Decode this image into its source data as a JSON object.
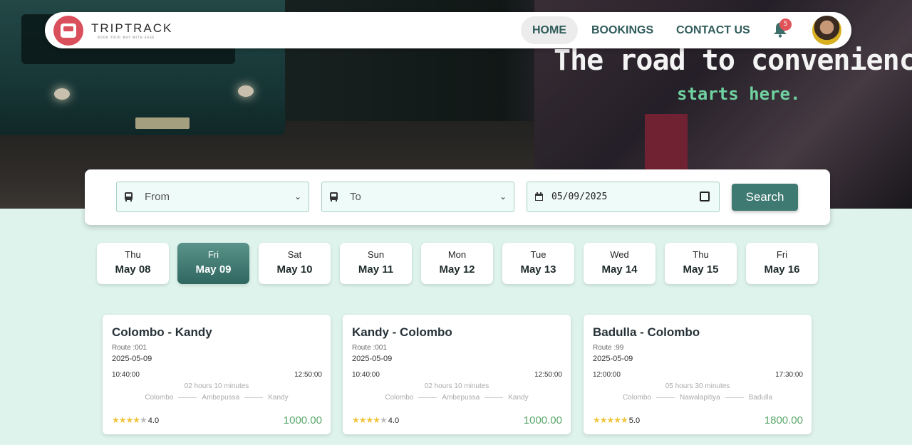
{
  "brand": {
    "name": "TRIPTRACK",
    "tagline": "BOOK YOUR WAY WITH EASE"
  },
  "nav": {
    "items": [
      {
        "label": "HOME",
        "active": true
      },
      {
        "label": "BOOKINGS",
        "active": false
      },
      {
        "label": "CONTACT US",
        "active": false
      }
    ],
    "notifications": "5"
  },
  "hero": {
    "headline": "The road to convenience",
    "subline": "starts here."
  },
  "search": {
    "from_placeholder": "From",
    "to_placeholder": "To",
    "date_value": "05/09/2025",
    "button_label": "Search"
  },
  "days": [
    {
      "weekday": "Thu",
      "date": "May 08",
      "selected": false
    },
    {
      "weekday": "Fri",
      "date": "May 09",
      "selected": true
    },
    {
      "weekday": "Sat",
      "date": "May 10",
      "selected": false
    },
    {
      "weekday": "Sun",
      "date": "May 11",
      "selected": false
    },
    {
      "weekday": "Mon",
      "date": "May 12",
      "selected": false
    },
    {
      "weekday": "Tue",
      "date": "May 13",
      "selected": false
    },
    {
      "weekday": "Wed",
      "date": "May 14",
      "selected": false
    },
    {
      "weekday": "Thu",
      "date": "May 15",
      "selected": false
    },
    {
      "weekday": "Fri",
      "date": "May 16",
      "selected": false
    }
  ],
  "trips": [
    {
      "title": "Colombo - Kandy",
      "route": "Route :001",
      "date": "2025-05-09",
      "departure": "10:40:00",
      "arrival": "12:50:00",
      "duration": "02 hours 10 minutes",
      "stops": [
        "Colombo",
        "Ambepussa",
        "Kandy"
      ],
      "rating": "4.0",
      "stars": 4,
      "price": "1000.00"
    },
    {
      "title": "Kandy - Colombo",
      "route": "Route :001",
      "date": "2025-05-09",
      "departure": "10:40:00",
      "arrival": "12:50:00",
      "duration": "02 hours 10 minutes",
      "stops": [
        "Colombo",
        "Ambepussa",
        "Kandy"
      ],
      "rating": "4.0",
      "stars": 4,
      "price": "1000.00"
    },
    {
      "title": "Badulla - Colombo",
      "route": "Route :99",
      "date": "2025-05-09",
      "departure": "12:00:00",
      "arrival": "17:30:00",
      "duration": "05 hours 30 minutes",
      "stops": [
        "Colombo",
        "Nawalapitiya",
        "Badulla"
      ],
      "rating": "5.0",
      "stars": 5,
      "price": "1800.00"
    }
  ],
  "colors": {
    "accent": "#3f7a72",
    "price": "#5aa86c",
    "badge": "#e05358",
    "page_bg": "#def3ec"
  }
}
